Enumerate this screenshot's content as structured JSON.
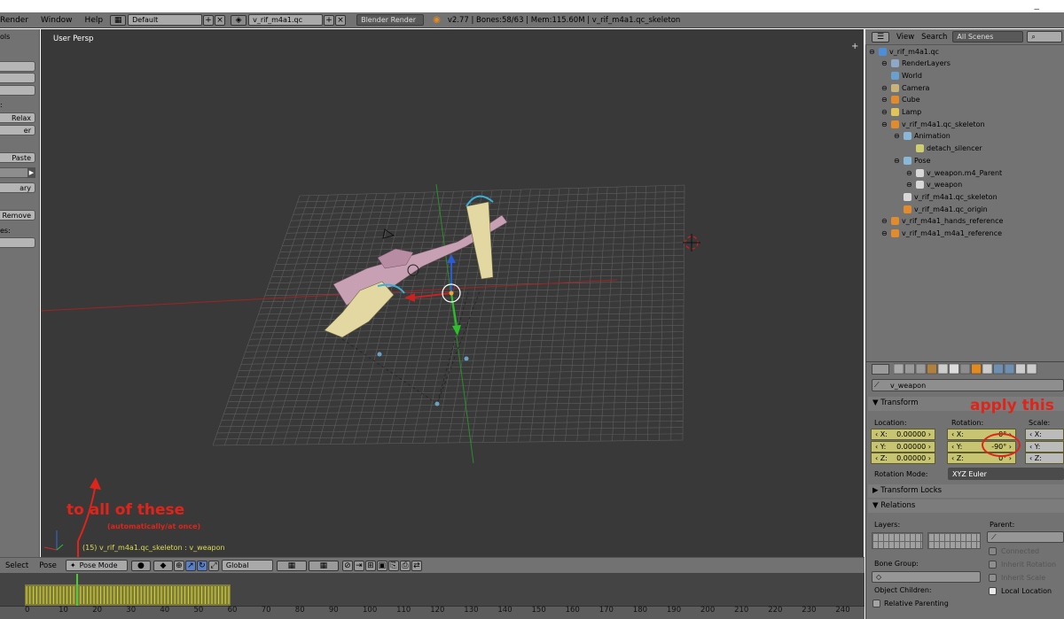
{
  "menubar": {
    "items": [
      "Render",
      "Window",
      "Help"
    ],
    "layout": "Default",
    "scene": "v_rif_m4a1.qc",
    "engine": "Blender Render",
    "info": "v2.77 | Bones:58/63 | Mem:115.60M | v_rif_m4a1.qc_skeleton"
  },
  "toolshelf": {
    "tab": "ols",
    "labels": [
      "Relax",
      "er",
      "Paste",
      "ary",
      "Remove",
      "es:"
    ],
    "colon": ":"
  },
  "viewport": {
    "label": "User Persp",
    "status": "(15) v_rif_m4a1.qc_skeleton : v_weapon"
  },
  "header": {
    "select": "Select",
    "pose": "Pose",
    "mode": "Pose Mode",
    "orientation": "Global"
  },
  "timeline": {
    "ticks": [
      "0",
      "10",
      "20",
      "30",
      "40",
      "50",
      "60",
      "70",
      "80",
      "90",
      "100",
      "110",
      "120",
      "130",
      "140",
      "150",
      "160",
      "170",
      "180",
      "190",
      "200",
      "210",
      "220",
      "230",
      "240"
    ]
  },
  "outliner": {
    "view": "View",
    "search": "Search",
    "filter": "All Scenes",
    "rows": [
      {
        "label": "v_rif_m4a1.qc",
        "indent": 0
      },
      {
        "label": "RenderLayers",
        "indent": 1
      },
      {
        "label": "World",
        "indent": 1
      },
      {
        "label": "Camera",
        "indent": 1
      },
      {
        "label": "Cube",
        "indent": 1
      },
      {
        "label": "Lamp",
        "indent": 1
      },
      {
        "label": "v_rif_m4a1.qc_skeleton",
        "indent": 1
      },
      {
        "label": "Animation",
        "indent": 2
      },
      {
        "label": "detach_silencer",
        "indent": 3
      },
      {
        "label": "Pose",
        "indent": 2
      },
      {
        "label": "v_weapon.m4_Parent",
        "indent": 3
      },
      {
        "label": "v_weapon",
        "indent": 3
      },
      {
        "label": "v_rif_m4a1.qc_skeleton",
        "indent": 2
      },
      {
        "label": "v_rif_m4a1.qc_origin",
        "indent": 2
      },
      {
        "label": "v_rif_m4a1_hands_reference",
        "indent": 1
      },
      {
        "label": "v_rif_m4a1_m4a1_reference",
        "indent": 1
      }
    ]
  },
  "properties": {
    "bone_name": "v_weapon",
    "transform": "Transform",
    "location_label": "Location:",
    "rotation_label": "Rotation:",
    "scale_label": "Scale:",
    "location": [
      {
        "axis": "X:",
        "value": "0.00000"
      },
      {
        "axis": "Y:",
        "value": "0.00000"
      },
      {
        "axis": "Z:",
        "value": "0.00000"
      }
    ],
    "rotation": [
      {
        "axis": "X:",
        "value": "0°"
      },
      {
        "axis": "Y:",
        "value": "-90°"
      },
      {
        "axis": "Z:",
        "value": "0°"
      }
    ],
    "scale": [
      {
        "axis": "X:"
      },
      {
        "axis": "Y:"
      },
      {
        "axis": "Z:"
      }
    ],
    "rotation_mode_label": "Rotation Mode:",
    "rotation_mode": "XYZ Euler",
    "transform_locks": "Transform Locks",
    "relations": "Relations",
    "layers": "Layers:",
    "parent": "Parent:",
    "connected": "Connected",
    "bone_group": "Bone Group:",
    "inherit_rotation": "Inherit Rotation",
    "inherit_scale": "Inherit Scale",
    "object_children": "Object Children:",
    "local_location": "Local Location",
    "relative_parenting": "Relative Parenting"
  },
  "annotations": {
    "apply": "apply this",
    "to_all": "to all of these",
    "auto": "(automatically/at once)"
  },
  "colors": {
    "annotation": "#e0241a",
    "viewport_bg": "#393939",
    "field_yellow": "#c7c572",
    "grid": "#5e5e5e"
  }
}
